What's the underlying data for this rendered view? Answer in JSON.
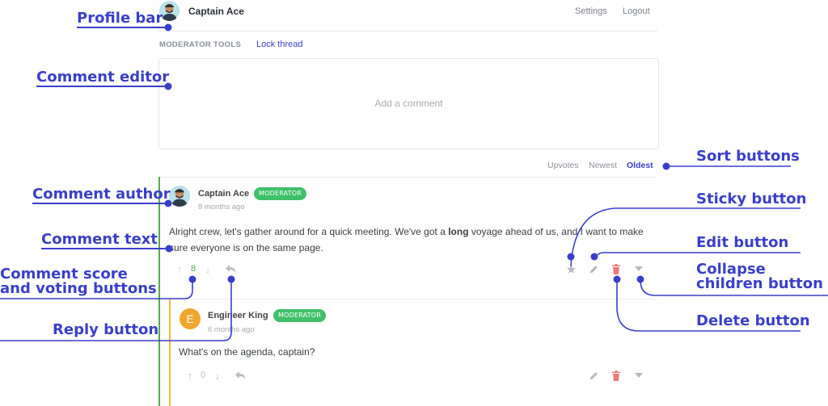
{
  "profile_bar": {
    "username": "Captain Ace",
    "settings_label": "Settings",
    "logout_label": "Logout"
  },
  "moderator_tools": {
    "title": "MODERATOR TOOLS",
    "lock_label": "Lock thread"
  },
  "editor": {
    "placeholder": "Add a comment"
  },
  "sort": {
    "upvotes": "Upvotes",
    "newest": "Newest",
    "oldest": "Oldest",
    "active": "Oldest"
  },
  "comments": [
    {
      "author": "Captain Ace",
      "badge": "MODERATOR",
      "time": "8 months ago",
      "text_before": "Alright crew, let's gather around for a quick meeting. We've got a ",
      "text_bold": "long",
      "text_after": " voyage ahead of us, and I want to make sure everyone is on the same page.",
      "score": "8",
      "thread_color": "#5aa94b"
    },
    {
      "author": "Engineer King",
      "avatar_letter": "E",
      "badge": "MODERATOR",
      "time": "6 months ago",
      "text": "What's on the agenda, captain?",
      "score": "0",
      "thread_color": "#f0b53a"
    }
  ],
  "annotations": {
    "profile_bar": "Profile bar",
    "comment_editor": "Comment editor",
    "comment_author": "Comment author",
    "comment_text": "Comment text",
    "comment_score": "Comment score and voting buttons",
    "reply_button": "Reply button",
    "sort_buttons": "Sort buttons",
    "sticky_button": "Sticky button",
    "edit_button": "Edit button",
    "collapse_children": "Collapse children button",
    "delete_button": "Delete button"
  },
  "colors": {
    "accent": "#3a3fc9",
    "badge": "#3fc06a",
    "delete": "#f07a7a",
    "score_up": "#4cae4f"
  }
}
